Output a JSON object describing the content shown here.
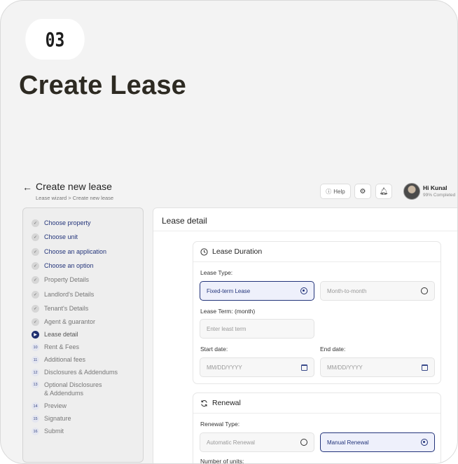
{
  "hero": {
    "step": "03",
    "title": "Create Lease"
  },
  "header": {
    "title": "Create new lease",
    "breadcrumb": "Lease wizard >  Create new lease",
    "help": "Help",
    "user_name": "Hi Kunal",
    "user_progress": "99% Completed"
  },
  "sidebar": {
    "items": [
      {
        "label": "Choose property",
        "state": "done-link"
      },
      {
        "label": "Choose unit",
        "state": "done-link"
      },
      {
        "label": "Choose an application",
        "state": "done-link"
      },
      {
        "label": "Choose an option",
        "state": "done-link"
      },
      {
        "label": "Property Details",
        "state": "done"
      },
      {
        "label": "Landlord's Details",
        "state": "done"
      },
      {
        "label": "Tenant's Details",
        "state": "done"
      },
      {
        "label": "Agent & guarantor",
        "state": "done"
      },
      {
        "label": "Lease detail",
        "state": "active"
      },
      {
        "label": "Rent & Fees",
        "num": "10"
      },
      {
        "label": "Additional fees",
        "num": "11"
      },
      {
        "label": "Disclosures & Addendums",
        "num": "12"
      },
      {
        "label": "Optional Disclosures",
        "label2": "& Addendums",
        "num": "13"
      },
      {
        "label": "Preview",
        "num": "14"
      },
      {
        "label": "Signature",
        "num": "15"
      },
      {
        "label": "Submit",
        "num": "16"
      }
    ]
  },
  "main": {
    "title": "Lease detail",
    "duration": {
      "heading": "Lease Duration",
      "lease_type_label": "Lease Type:",
      "fixed_term": "Fixed-term Lease",
      "month_to_month": "Month-to-month",
      "term_label": "Lease Term: (month)",
      "term_placeholder": "Enter least term",
      "start_label": "Start date:",
      "end_label": "End date:",
      "date_placeholder": "MM/DD/YYYY"
    },
    "renewal": {
      "heading": "Renewal",
      "type_label": "Renewal Type:",
      "automatic": "Automatic Renewal",
      "manual": "Manual Renewal",
      "units_label": "Number of units:"
    }
  },
  "colors": {
    "accent": "#23347a",
    "background": "#f3f3f3"
  }
}
